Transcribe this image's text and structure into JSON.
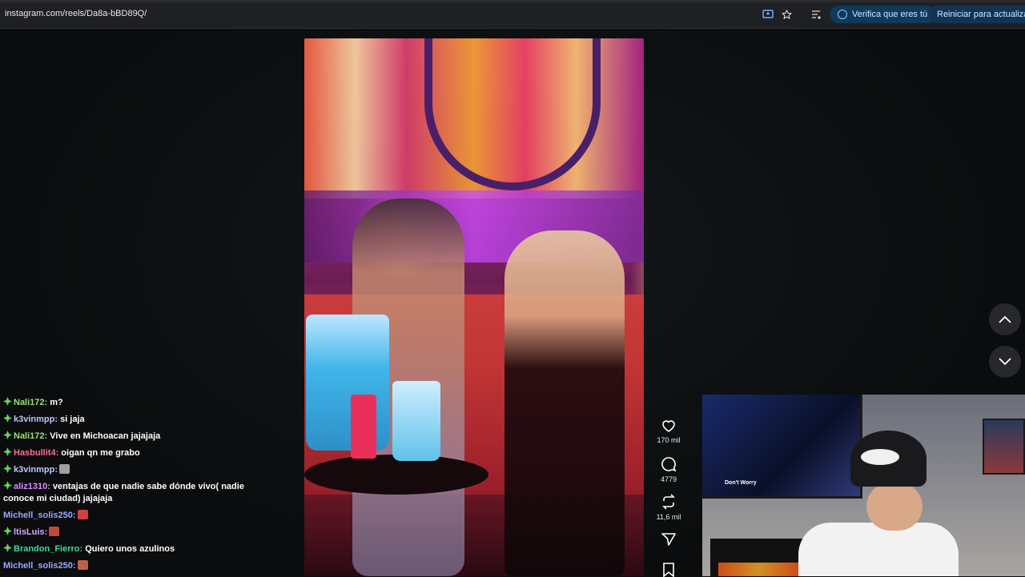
{
  "browser": {
    "url": "instagram.com/reels/Da8a-bBD89Q/",
    "verify_label": "Verifica que eres tú",
    "update_label": "Reiniciar para actualizar"
  },
  "reel": {
    "likes": "170 mil",
    "comments": "4779",
    "reposts": "11,6 mil"
  },
  "webcam": {
    "tv_caption": "Don't Worry"
  },
  "chat": [
    {
      "user": "Nali172:",
      "text": " m?",
      "color": "#9be36b"
    },
    {
      "user": "k3vinmpp:",
      "text": " si jaja",
      "color": "#b9c7ff"
    },
    {
      "user": "Nali172:",
      "text": " Vive en Michoacan jajajaja",
      "color": "#9be36b"
    },
    {
      "user": "Hasbullit4:",
      "text": " oigan qn me grabo",
      "color": "#ff6f91"
    },
    {
      "user": "k3vinmpp:",
      "text": "",
      "color": "#b9c7ff"
    },
    {
      "user": "aliz1310:",
      "text": " ventajas de que nadie sabe dónde vivo( nadie conoce mi ciudad) jajajaja",
      "color": "#e08cff"
    },
    {
      "user": "Michell_solis250:",
      "text": "",
      "color": "#9aa8ff"
    },
    {
      "user": "ltisLuis:",
      "text": "",
      "color": "#d7a7ff"
    },
    {
      "user": "Brandon_Fierro:",
      "text": " Quiero unos azulinos",
      "color": "#3fd9a0"
    },
    {
      "user": "Michell_solis250:",
      "text": "",
      "color": "#9aa8ff"
    }
  ]
}
